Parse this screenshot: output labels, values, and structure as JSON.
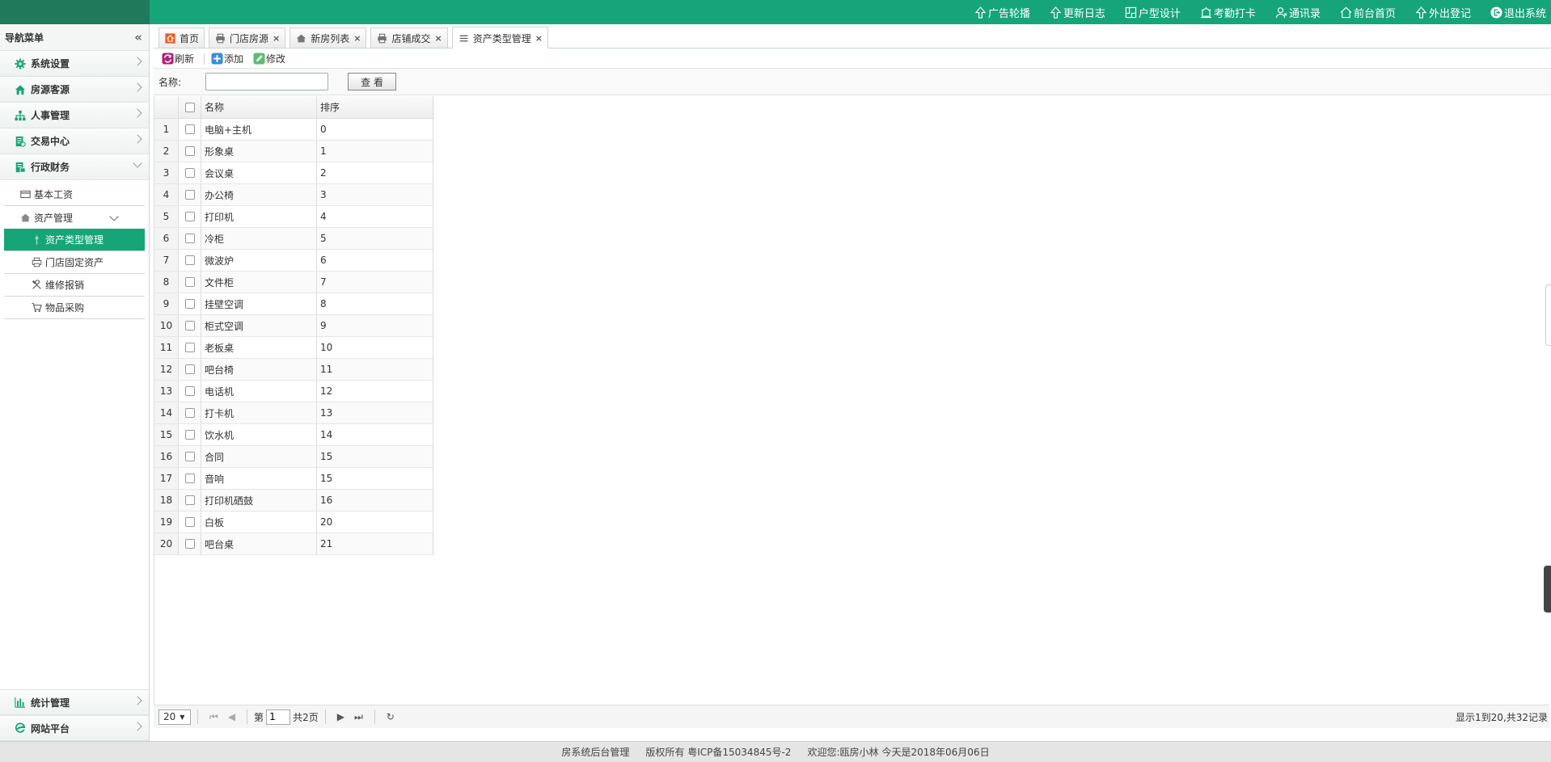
{
  "topbar": {
    "links": [
      "广告轮播",
      "更新日志",
      "户型设计",
      "考勤打卡",
      "通讯录",
      "前台首页",
      "外出登记",
      "退出系统"
    ]
  },
  "sidebar": {
    "title": "导航菜单",
    "collapse_icon": "«",
    "groups": [
      "系统设置",
      "房源客源",
      "人事管理",
      "交易中心",
      "行政财务"
    ],
    "sub_items": {
      "basic_salary": "基本工资",
      "asset_mgmt": "资产管理",
      "asset_type_mgmt": "资产类型管理",
      "store_fixed_assets": "门店固定资产",
      "repair_claim": "维修报销",
      "purchase": "物品采购"
    },
    "bottom_groups": [
      "统计管理",
      "网站平台"
    ]
  },
  "tabs": [
    {
      "label": "首页",
      "closable": false
    },
    {
      "label": "门店房源",
      "closable": true
    },
    {
      "label": "新房列表",
      "closable": true
    },
    {
      "label": "店铺成交",
      "closable": true
    },
    {
      "label": "资产类型管理",
      "closable": true
    }
  ],
  "toolbar": {
    "refresh": "刷新",
    "add": "添加",
    "edit": "修改"
  },
  "search": {
    "name_label": "名称:",
    "name_value": "",
    "button": "查 看"
  },
  "grid": {
    "columns": [
      "名称",
      "排序"
    ],
    "rows": [
      {
        "num": "1",
        "name": "电脑+主机",
        "sort": "0"
      },
      {
        "num": "2",
        "name": "形象桌",
        "sort": "1"
      },
      {
        "num": "3",
        "name": "会议桌",
        "sort": "2"
      },
      {
        "num": "4",
        "name": "办公椅",
        "sort": "3"
      },
      {
        "num": "5",
        "name": "打印机",
        "sort": "4"
      },
      {
        "num": "6",
        "name": "冷柜",
        "sort": "5"
      },
      {
        "num": "7",
        "name": "微波炉",
        "sort": "6"
      },
      {
        "num": "8",
        "name": "文件柜",
        "sort": "7"
      },
      {
        "num": "9",
        "name": "挂壁空调",
        "sort": "8"
      },
      {
        "num": "10",
        "name": "柜式空调",
        "sort": "9"
      },
      {
        "num": "11",
        "name": "老板桌",
        "sort": "10"
      },
      {
        "num": "12",
        "name": "吧台椅",
        "sort": "11"
      },
      {
        "num": "13",
        "name": "电话机",
        "sort": "12"
      },
      {
        "num": "14",
        "name": "打卡机",
        "sort": "13"
      },
      {
        "num": "15",
        "name": "饮水机",
        "sort": "14"
      },
      {
        "num": "16",
        "name": "合同",
        "sort": "15"
      },
      {
        "num": "17",
        "name": "音响",
        "sort": "15"
      },
      {
        "num": "18",
        "name": "打印机硒鼓",
        "sort": "16"
      },
      {
        "num": "19",
        "name": "白板",
        "sort": "20"
      },
      {
        "num": "20",
        "name": "吧台桌",
        "sort": "21"
      }
    ]
  },
  "pager": {
    "page_size": "20",
    "page_prefix": "第",
    "page_value": "1",
    "page_total": "共2页",
    "info": "显示1到20,共32记录"
  },
  "footer": {
    "system": "房系统后台管理",
    "copyright": "版权所有 粤ICP备15034845号-2",
    "welcome": "欢迎您:瓯房小林",
    "today": "今天是2018年06月06日"
  },
  "colors": {
    "accent": "#16a578",
    "dark_accent": "#1e7a5a"
  }
}
